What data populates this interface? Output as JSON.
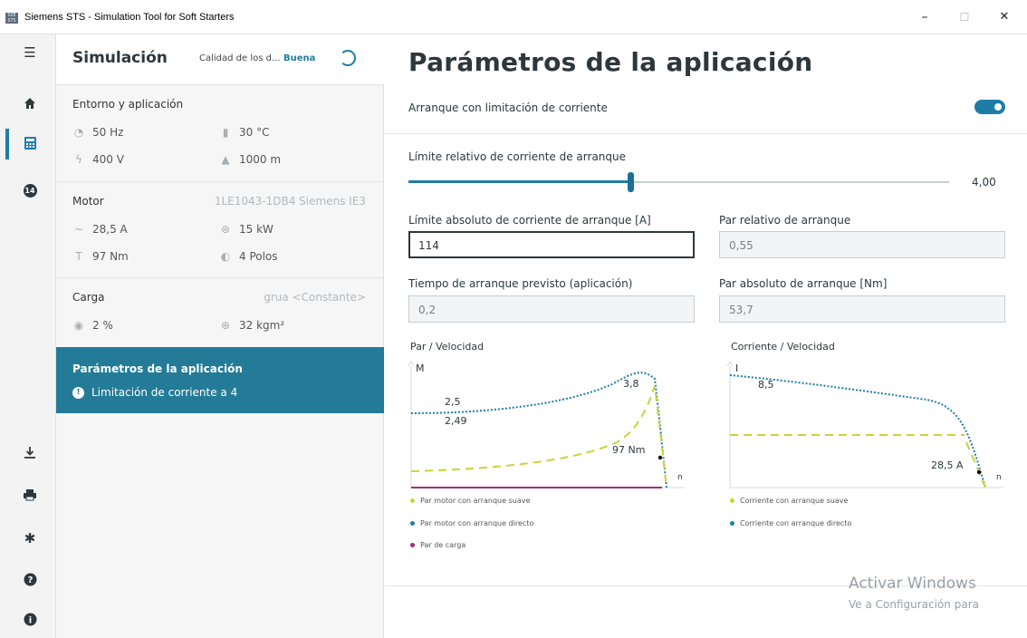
{
  "window": {
    "title": "Siemens STS - Simulation Tool for Soft Starters",
    "minimize": "–",
    "maximize": "☐",
    "close": "✕"
  },
  "left_nav": {
    "badge": "14"
  },
  "sidebar": {
    "header": {
      "title": "Simulación",
      "quality_label": "Calidad de los d...",
      "quality_value": "Buena"
    },
    "environment": {
      "title": "Entorno y aplicación",
      "frequency": "50 Hz",
      "temperature": "30 °C",
      "voltage": "400 V",
      "altitude": "1000 m"
    },
    "motor": {
      "title": "Motor",
      "model": "1LE1043-1DB4 Siemens IE3",
      "current": "28,5 A",
      "power": "15 kW",
      "torque": "97 Nm",
      "poles": "4 Polos"
    },
    "load": {
      "title": "Carga",
      "type": "grua <Constante>",
      "percent": "2 %",
      "inertia": "32 kgm²"
    },
    "active": {
      "title": "Parámetros de la aplicación",
      "info": "Limitación de corriente a 4"
    }
  },
  "main": {
    "title": "Parámetros de la aplicación",
    "start_mode_label": "Arranque con limitación de corriente",
    "start_mode_enabled": true,
    "slider": {
      "label": "Límite relativo de corriente de arranque",
      "value": "4,00",
      "fraction": 0.41
    },
    "fields": {
      "abs_current_label": "Límite absoluto de corriente de arranque [A]",
      "abs_current_value": "114",
      "rel_torque_label": "Par relativo de arranque",
      "rel_torque_value": "0,55",
      "start_time_label": "Tiempo de arranque previsto (aplicación)",
      "start_time_value": "0,2",
      "abs_torque_label": "Par absoluto de arranque [Nm]",
      "abs_torque_value": "53,7"
    },
    "chart1": {
      "title": "Par / Velocidad",
      "y_axis": "M",
      "x_axis": "n",
      "label_a": "2,5",
      "label_b": "2,49",
      "label_peak": "3,8",
      "label_nominal": "97 Nm",
      "legend": [
        "Par motor con arranque suave",
        "Par motor con arranque directo",
        "Par de carga"
      ]
    },
    "chart2": {
      "title": "Corriente / Velocidad",
      "y_axis": "I",
      "x_axis": "n",
      "label_start": "8,5",
      "label_nominal": "28,5 A",
      "legend": [
        "Corriente con arranque suave",
        "Corriente con arranque directo"
      ]
    },
    "watermark_1": "Activar Windows",
    "watermark_2": "Ve a Configuración para"
  },
  "colors": {
    "accent": "#1e7da6",
    "active_panel": "#237b98",
    "soft_start": "#c8d43a",
    "direct_start": "#1e7da6",
    "load": "#a0307a"
  }
}
